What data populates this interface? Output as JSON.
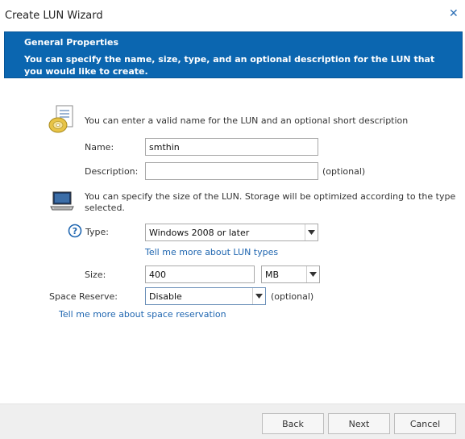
{
  "window": {
    "title": "Create LUN Wizard",
    "close_symbol": "✕"
  },
  "banner": {
    "title": "General Properties",
    "description": "You can specify the name, size, type, and an optional description for the LUN that you would like to create."
  },
  "name_section": {
    "icon": "cd-document-icon",
    "intro": "You can enter a valid name for the LUN and an optional short description",
    "name_label": "Name:",
    "name_value": "smthin",
    "description_label": "Description:",
    "description_value": "",
    "description_hint": "(optional)"
  },
  "size_section": {
    "icon": "laptop-icon",
    "intro_line1": "You can specify the size of the LUN. Storage will be optimized according to the type",
    "intro_line2": "selected.",
    "help_icon": "question-circle-icon",
    "type_label": "Type:",
    "type_value": "Windows 2008 or later",
    "type_link": "Tell me more about LUN types",
    "size_label": "Size:",
    "size_value": "400",
    "size_unit": "MB",
    "space_reserve_label": "Space Reserve:",
    "space_reserve_value": "Disable",
    "space_reserve_hint": "(optional)",
    "space_reserve_link": "Tell me more about space reservation"
  },
  "footer": {
    "back_label": "Back",
    "next_label": "Next",
    "cancel_label": "Cancel"
  },
  "colors": {
    "banner_bg": "#0b66b0",
    "link": "#1f66b0",
    "close_icon": "#2c6fb6"
  }
}
